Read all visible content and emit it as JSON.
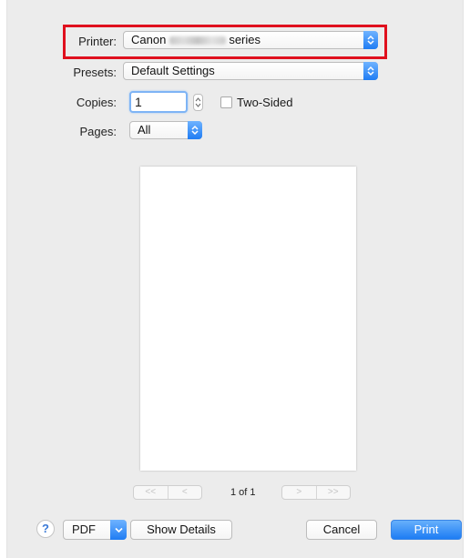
{
  "printer": {
    "label": "Printer:",
    "value_prefix": "Canon",
    "value_suffix": "series"
  },
  "presets": {
    "label": "Presets:",
    "value": "Default Settings"
  },
  "copies": {
    "label": "Copies:",
    "value": "1",
    "two_sided_label": "Two-Sided",
    "two_sided_checked": false
  },
  "pages": {
    "label": "Pages:",
    "value": "All"
  },
  "preview": {
    "page_indicator": "1 of 1",
    "first_label": "<<",
    "prev_label": "<",
    "next_label": ">",
    "last_label": ">>"
  },
  "footer": {
    "help_label": "?",
    "pdf_label": "PDF",
    "show_details_label": "Show Details",
    "cancel_label": "Cancel",
    "print_label": "Print"
  },
  "colors": {
    "accent": "#1f7cf3",
    "highlight_box": "#e0101e"
  },
  "icons": {
    "popup_arrows": "chevron-up-down-icon",
    "pdf_menu": "chevron-down-icon",
    "stepper": "stepper-icon",
    "help": "question-icon"
  }
}
